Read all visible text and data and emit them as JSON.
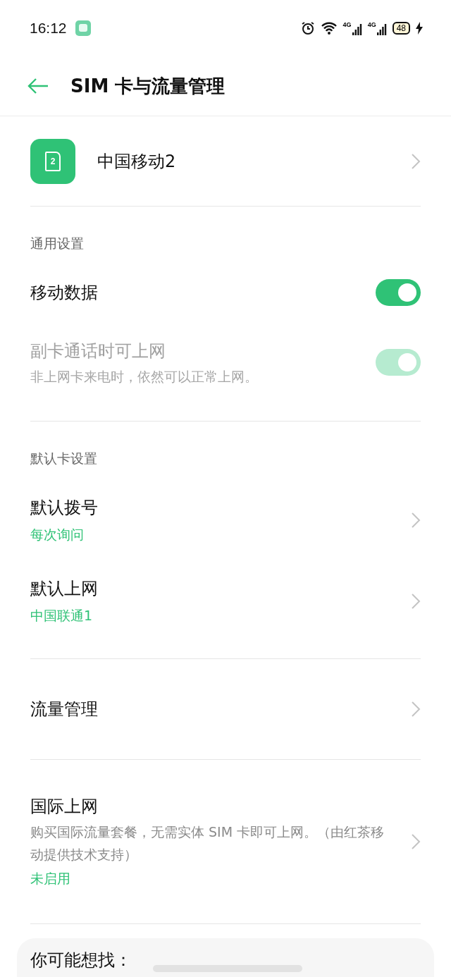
{
  "status_bar": {
    "time": "16:12",
    "network_labels": [
      "4G",
      "4G"
    ],
    "battery": "48"
  },
  "header": {
    "title": "SIM 卡与流量管理"
  },
  "sim": {
    "badge": "2",
    "name": "中国移动2"
  },
  "groups": [
    {
      "heading": "通用设置",
      "items": [
        {
          "kind": "toggle",
          "title": "移动数据",
          "on": true,
          "disabled": false
        },
        {
          "kind": "toggle",
          "title": "副卡通话时可上网",
          "subtitle": "非上网卡来电时，依然可以正常上网。",
          "on": true,
          "disabled": true
        }
      ]
    },
    {
      "heading": "默认卡设置",
      "items": [
        {
          "kind": "link",
          "title": "默认拨号",
          "value": "每次询问"
        },
        {
          "kind": "link",
          "title": "默认上网",
          "value": "中国联通1"
        }
      ]
    },
    {
      "items": [
        {
          "kind": "link",
          "title": "流量管理"
        }
      ]
    },
    {
      "items": [
        {
          "kind": "link",
          "title": "国际上网",
          "subtitle": "购买国际流量套餐，无需实体 SIM 卡即可上网。（由红茶移动提供技术支持）",
          "value": "未启用"
        }
      ]
    }
  ],
  "suggestions": {
    "title": "你可能想找："
  }
}
